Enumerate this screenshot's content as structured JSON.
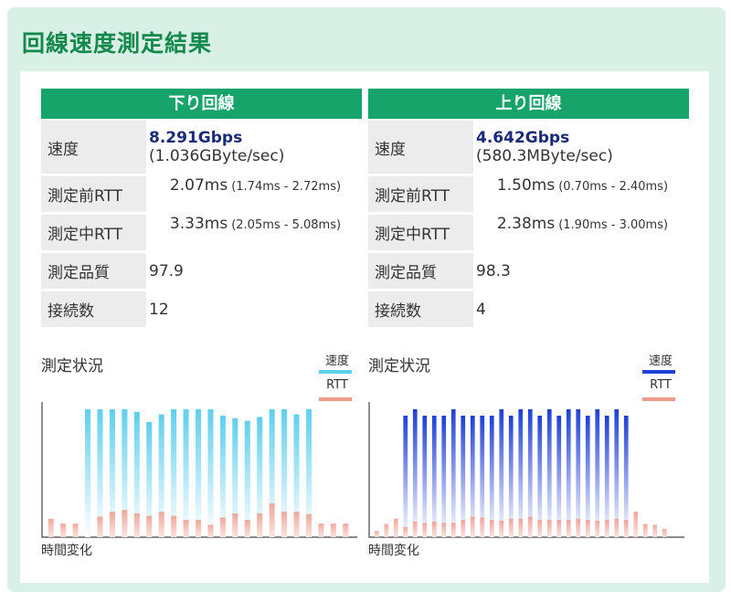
{
  "page": {
    "title": "回線速度測定結果"
  },
  "down": {
    "header": "下り回線",
    "rows": [
      {
        "label": "速度",
        "main": "8.291Gbps",
        "sub": "(1.036GByte/sec)"
      },
      {
        "label": "測定前RTT",
        "main": "2.07ms",
        "range": "(1.74ms - 2.72ms)"
      },
      {
        "label": "測定中RTT",
        "main": "3.33ms",
        "range": "(2.05ms - 5.08ms)"
      },
      {
        "label": "測定品質",
        "main": "97.9"
      },
      {
        "label": "接続数",
        "main": "12"
      }
    ],
    "chart": {
      "label": "測定状況",
      "legend_speed": "速度",
      "legend_rtt": "RTT",
      "xlabel": "時間変化"
    }
  },
  "up": {
    "header": "上り回線",
    "rows": [
      {
        "label": "速度",
        "main": "4.642Gbps",
        "sub": "(580.3MByte/sec)"
      },
      {
        "label": "測定前RTT",
        "main": "1.50ms",
        "range": "(0.70ms - 2.40ms)"
      },
      {
        "label": "測定中RTT",
        "main": "2.38ms",
        "range": "(1.90ms - 3.00ms)"
      },
      {
        "label": "測定品質",
        "main": "98.3"
      },
      {
        "label": "接続数",
        "main": "4"
      }
    ],
    "chart": {
      "label": "測定状況",
      "legend_speed": "速度",
      "legend_rtt": "RTT",
      "xlabel": "時間変化"
    }
  },
  "colors": {
    "down_speed": "#5fcfee",
    "up_speed": "#1f3fd6",
    "rtt": "#f09a8c",
    "header": "#17a46a",
    "title": "#138a4c"
  },
  "chart_data": [
    {
      "type": "bar",
      "series": [
        {
          "name": "速度",
          "values": [
            0,
            0,
            0,
            1.0,
            1.0,
            1.0,
            1.0,
            0.98,
            0.9,
            0.96,
            1.0,
            1.0,
            1.0,
            1.0,
            0.95,
            0.93,
            0.91,
            0.94,
            1.0,
            1.0,
            0.96,
            1.0,
            0,
            0,
            0
          ]
        },
        {
          "name": "RTT",
          "values": [
            0.45,
            0.33,
            0.33,
            0,
            0.5,
            0.62,
            0.66,
            0.58,
            0.52,
            0.62,
            0.52,
            0.42,
            0.42,
            0.3,
            0.48,
            0.58,
            0.42,
            0.58,
            0.82,
            0.62,
            0.62,
            0.56,
            0.33,
            0.33,
            0.33
          ]
        }
      ]
    },
    {
      "type": "bar",
      "series": [
        {
          "name": "速度",
          "values": [
            0,
            0,
            0,
            0.95,
            1.0,
            0.95,
            0.95,
            0.95,
            1.0,
            0.95,
            0.95,
            0.95,
            0.95,
            1.0,
            0.95,
            1.0,
            1.0,
            0.95,
            1.0,
            0.95,
            1.0,
            1.0,
            0.95,
            1.0,
            0.95,
            1.0,
            0.95,
            0,
            0,
            0,
            0,
            0
          ]
        },
        {
          "name": "RTT",
          "values": [
            0.15,
            0.32,
            0.45,
            0.25,
            0.38,
            0.35,
            0.38,
            0.35,
            0.35,
            0.42,
            0.5,
            0.48,
            0.42,
            0.4,
            0.45,
            0.45,
            0.5,
            0.42,
            0.42,
            0.42,
            0.42,
            0.45,
            0.42,
            0.4,
            0.42,
            0.45,
            0.42,
            0.62,
            0.32,
            0.3,
            0.2,
            0
          ]
        }
      ]
    }
  ]
}
